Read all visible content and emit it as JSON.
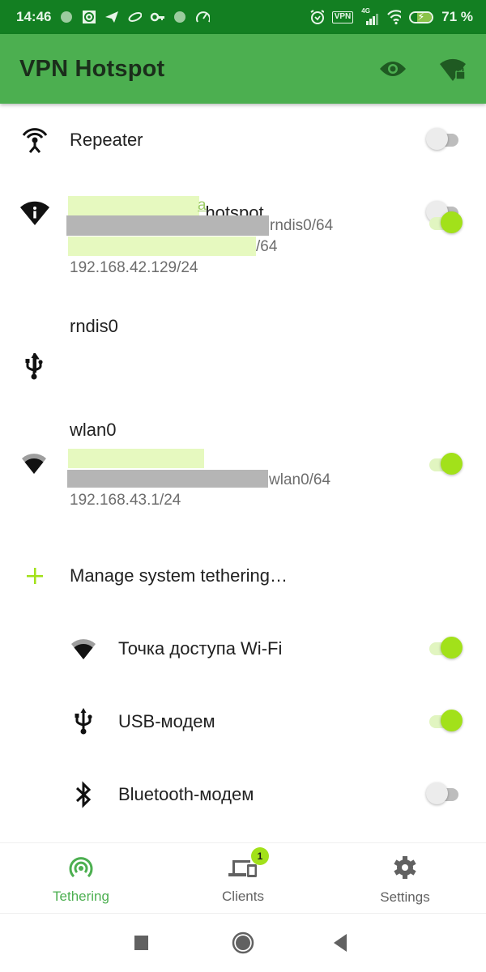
{
  "status_bar": {
    "time": "14:46",
    "left_icons": [
      "notification-dot-icon",
      "camera-app-icon",
      "telegram-icon",
      "app-swoosh-icon",
      "key-icon",
      "notification-dot-icon",
      "speedometer-icon"
    ],
    "right_icons": [
      "alarm-icon",
      "vpn-icon",
      "cellular-4g-icon",
      "wifi-icon",
      "battery-charging-icon"
    ],
    "vpn_label": "VPN",
    "network_label": "4G",
    "battery": "71 %",
    "battery_level_percent": 71
  },
  "app_bar": {
    "title": "VPN Hotspot",
    "actions": [
      "eye-icon",
      "wifi-lock-icon"
    ]
  },
  "items": {
    "repeater": {
      "label": "Repeater",
      "icon": "repeater-antenna-icon",
      "enabled": false
    },
    "temp_hotspot": {
      "label": "Temporary Wi-Fi hotspot",
      "icon": "wifi-info-icon",
      "enabled": false
    },
    "rndis": {
      "name": "rndis0",
      "icon": "usb-icon",
      "enabled": true,
      "addr_line_1_suffix": "a",
      "addr_line_2_suffix": "rndis0/64",
      "addr_line_3_suffix": "/64",
      "ipv4": "192.168.42.129/24"
    },
    "wlan": {
      "name": "wlan0",
      "icon": "wifi-icon",
      "enabled": true,
      "addr_line_2_suffix": "wlan0/64",
      "ipv4": "192.168.43.1/24"
    },
    "manage": {
      "label": "Manage system tethering…",
      "icon": "plus-icon"
    },
    "wifi_ap": {
      "label": "Точка доступа Wi-Fi",
      "icon": "wifi-icon",
      "enabled": true
    },
    "usb_modem": {
      "label": "USB-модем",
      "icon": "usb-icon",
      "enabled": true
    },
    "bt_modem": {
      "label": "Bluetooth-модем",
      "icon": "bluetooth-icon",
      "enabled": false
    }
  },
  "bottom_nav": {
    "tabs": [
      {
        "label": "Tethering",
        "icon": "tethering-icon",
        "active": true
      },
      {
        "label": "Clients",
        "icon": "devices-icon",
        "badge": "1"
      },
      {
        "label": "Settings",
        "icon": "gear-icon"
      }
    ]
  },
  "system_nav": [
    "recents-button",
    "home-button",
    "back-button"
  ],
  "colors": {
    "status_bar": "#137f22",
    "app_bar": "#4caf50",
    "accent": "#a2e11a",
    "active_tab": "#4caf50"
  }
}
